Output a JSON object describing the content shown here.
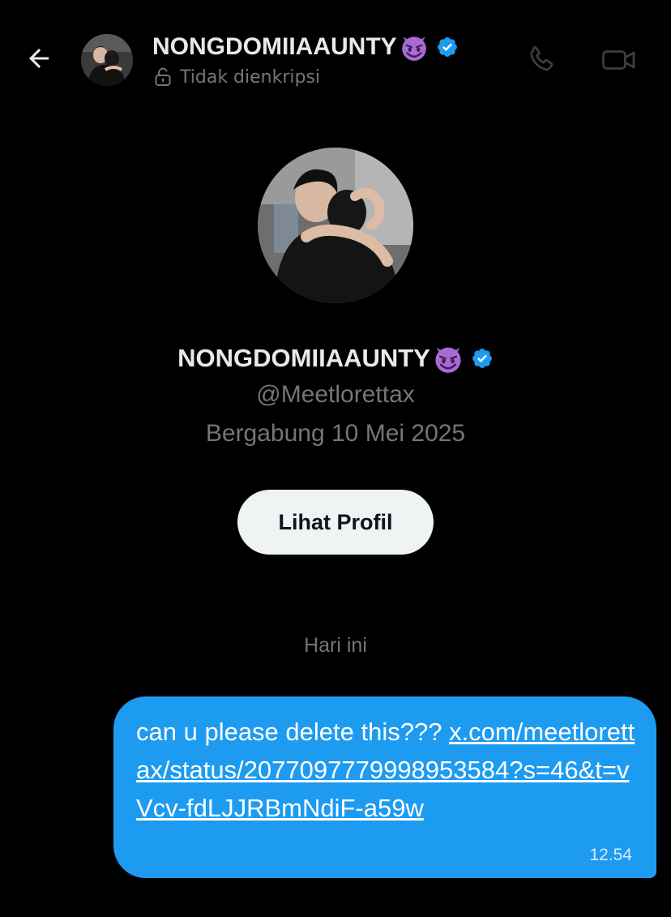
{
  "header": {
    "name": "NONGDOMIIAAUNTY",
    "emoji": "smiling-imp",
    "verified": true,
    "subtitle": "Tidak dienkripsi",
    "back_icon": "arrow-left-icon",
    "call_icon": "phone-icon",
    "video_icon": "video-camera-icon"
  },
  "profile": {
    "name": "NONGDOMIIAAUNTY",
    "handle": "@Meetlorettax",
    "joined": "Bergabung 10 Mei 2025",
    "view_profile_label": "Lihat Profil"
  },
  "conversation": {
    "date_divider": "Hari ini",
    "messages": [
      {
        "text": "can u please delete this??? ",
        "link": "x.com/meetlorettax/status/2077097779998953584?s=46&t=vVcv-fdLJJRBmNdiF-a59w",
        "time": "12.54",
        "outgoing": true
      }
    ]
  },
  "colors": {
    "background": "#000000",
    "accent": "#1d9bf0",
    "secondary_text": "#71767b",
    "primary_text": "#e7e9ea",
    "button_bg": "#eff3f4"
  }
}
